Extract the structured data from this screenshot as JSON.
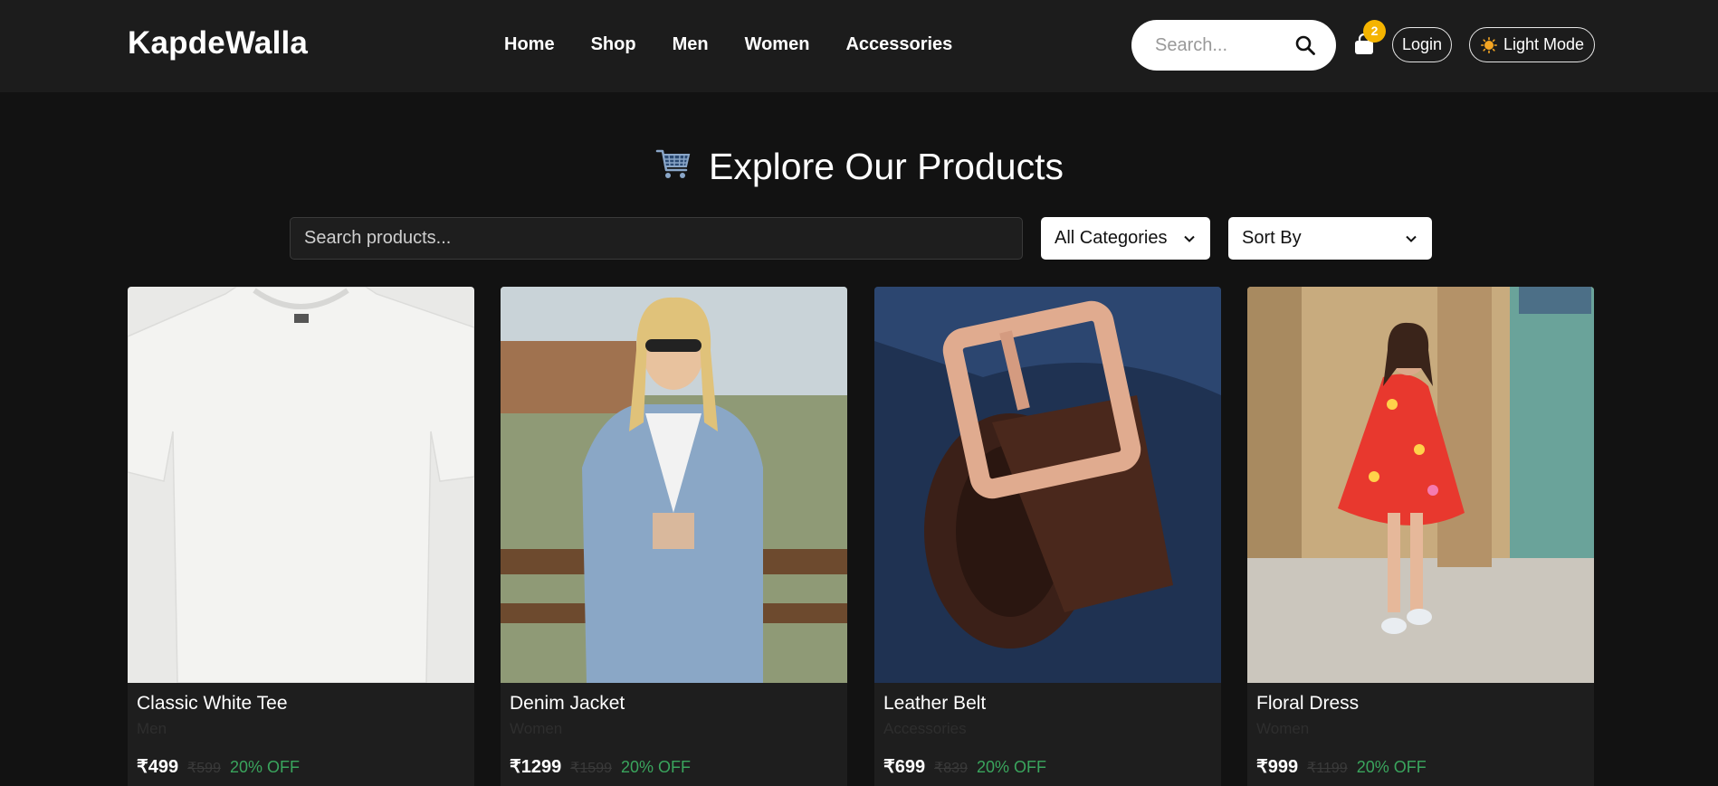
{
  "header": {
    "brand": "KapdeWalla",
    "nav": [
      "Home",
      "Shop",
      "Men",
      "Women",
      "Accessories"
    ],
    "search_placeholder": "Search...",
    "cart_count": "2",
    "login_label": "Login",
    "mode_label": "Light Mode"
  },
  "main": {
    "title": "Explore Our Products",
    "search_placeholder": "Search products...",
    "category_select": "All Categories",
    "sort_select": "Sort By"
  },
  "products": [
    {
      "name": "Classic White Tee",
      "category": "Men",
      "price": "₹499",
      "old_price": "₹599",
      "discount": "20% OFF"
    },
    {
      "name": "Denim Jacket",
      "category": "Women",
      "price": "₹1299",
      "old_price": "₹1599",
      "discount": "20% OFF"
    },
    {
      "name": "Leather Belt",
      "category": "Accessories",
      "price": "₹699",
      "old_price": "₹839",
      "discount": "20% OFF"
    },
    {
      "name": "Floral Dress",
      "category": "Women",
      "price": "₹999",
      "old_price": "₹1199",
      "discount": "20% OFF"
    }
  ],
  "colors": {
    "header_bg": "#1c1c1c",
    "page_bg": "#121212",
    "badge": "#f5b400",
    "discount": "#3aa55d"
  }
}
